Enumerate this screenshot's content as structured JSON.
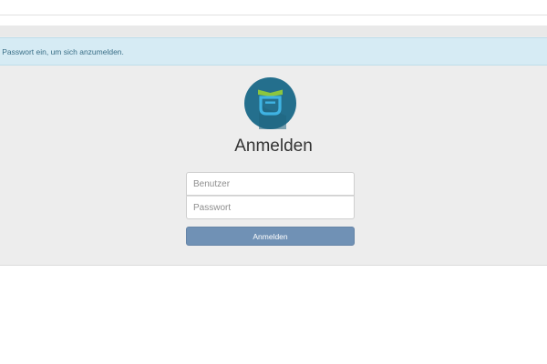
{
  "alert": {
    "text": "r Passwort ein, um sich anzumelden."
  },
  "logo": {
    "icon": "privacyidea-logo-icon",
    "bg_color": "#246f8d",
    "accent_top": "#8cc63f",
    "accent_bottom": "#3fb3e3"
  },
  "login": {
    "title": "Anmelden",
    "username_placeholder": "Benutzer",
    "username_value": "",
    "password_placeholder": "Passwort",
    "password_value": "",
    "submit_label": "Anmelden"
  },
  "colors": {
    "button": "#7091b5",
    "alert_bg": "#d6ebf4",
    "alert_text": "#3a6f87"
  }
}
